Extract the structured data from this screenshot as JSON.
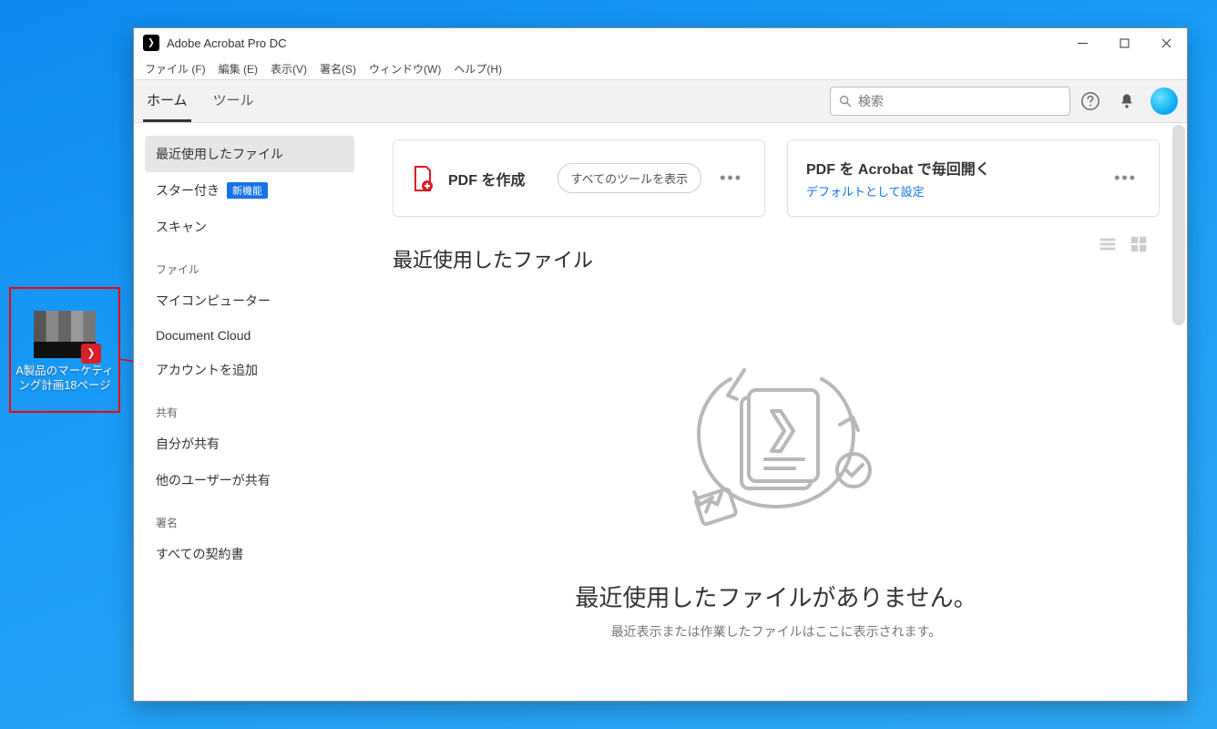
{
  "desktop": {
    "icon_label": "A製品のマーケティング計画18ページ"
  },
  "window": {
    "title": "Adobe Acrobat Pro DC"
  },
  "menubar": {
    "file": "ファイル (F)",
    "edit": "編集 (E)",
    "view": "表示(V)",
    "sign": "署名(S)",
    "window": "ウィンドウ(W)",
    "help": "ヘルプ(H)"
  },
  "toolbar": {
    "tab_home": "ホーム",
    "tab_tools": "ツール",
    "search_placeholder": "検索"
  },
  "sidebar": {
    "recent": "最近使用したファイル",
    "starred": "スター付き",
    "starred_badge": "新機能",
    "scan": "スキャン",
    "section_file": "ファイル",
    "my_computer": "マイコンピューター",
    "document_cloud": "Document Cloud",
    "add_account": "アカウントを追加",
    "section_share": "共有",
    "shared_by_me": "自分が共有",
    "shared_by_others": "他のユーザーが共有",
    "section_sign": "署名",
    "all_agreements": "すべての契約書"
  },
  "cards": {
    "create_pdf": "PDF を作成",
    "show_all_tools": "すべてのツールを表示",
    "open_every_time_title": "PDF を Acrobat で毎回開く",
    "open_every_time_link": "デフォルトとして設定"
  },
  "main": {
    "recent_heading": "最近使用したファイル",
    "empty_big": "最近使用したファイルがありません。",
    "empty_small": "最近表示または作業したファイルはここに表示されます。"
  }
}
